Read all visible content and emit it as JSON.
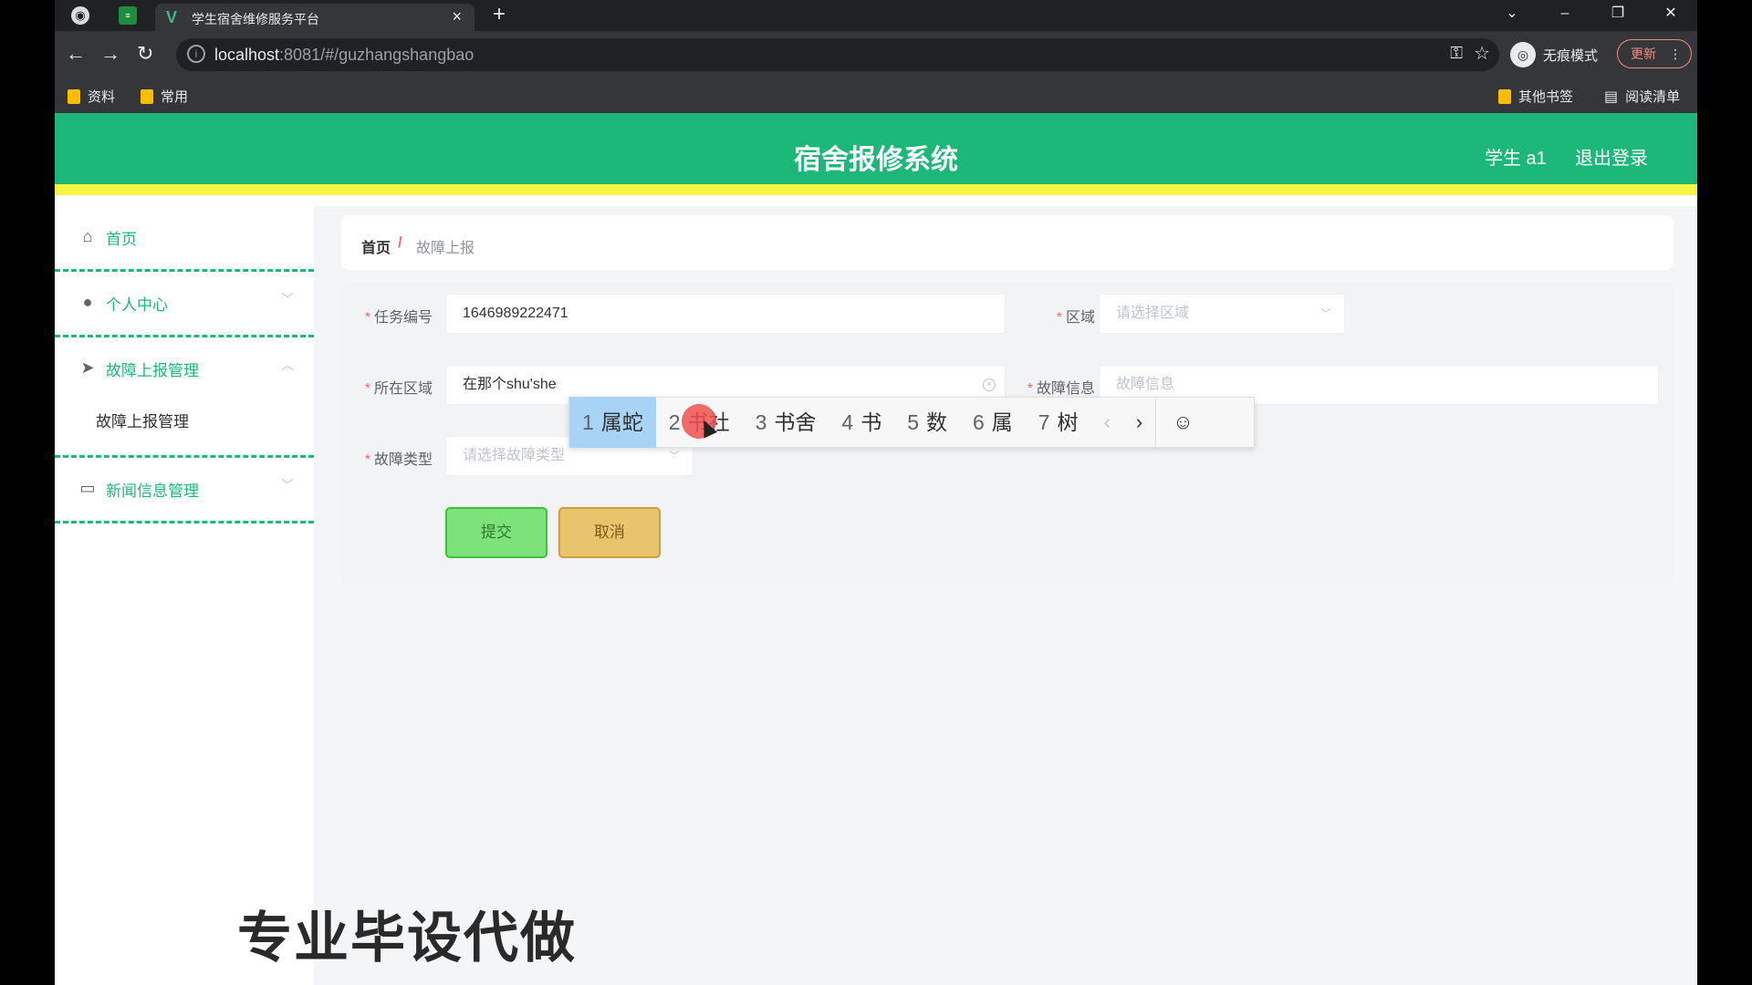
{
  "browser": {
    "tab_title": "学生宿舍维修服务平台",
    "tab_close": "×",
    "new_tab": "+",
    "url_host": "localhost",
    "url_rest": ":8081/#/guzhangshangbao",
    "incognito_label": "无痕模式",
    "update_label": "更新",
    "bookmarks": [
      "资料",
      "常用"
    ],
    "other_bookmarks": "其他书签",
    "reading_list": "阅读清单"
  },
  "header": {
    "title": "宿舍报修系统",
    "user": "学生 a1",
    "logout": "退出登录"
  },
  "sidebar": {
    "items": [
      {
        "label": "首页",
        "icon": "home-icon"
      },
      {
        "label": "个人中心",
        "icon": "user-icon"
      },
      {
        "label": "故障上报管理",
        "icon": "send-icon"
      },
      {
        "label": "新闻信息管理",
        "icon": "news-icon"
      }
    ],
    "submenu_item": "故障上报管理"
  },
  "breadcrumb": {
    "home": "首页",
    "separator": "/",
    "current": "故障上报"
  },
  "form": {
    "task_no_label": "任务编号",
    "task_no_value": "1646989222471",
    "area_label": "区域",
    "area_placeholder": "请选择区域",
    "location_label": "所在区域",
    "location_value": "在那个shu'she",
    "fault_info_label": "故障信息",
    "fault_info_placeholder": "故障信息",
    "fault_type_label": "故障类型",
    "fault_type_placeholder": "请选择故障类型",
    "submit": "提交",
    "cancel": "取消"
  },
  "ime": {
    "candidates": [
      {
        "num": "1",
        "text": "属蛇"
      },
      {
        "num": "2",
        "text": "书社"
      },
      {
        "num": "3",
        "text": "书舍"
      },
      {
        "num": "4",
        "text": "书"
      },
      {
        "num": "5",
        "text": "数"
      },
      {
        "num": "6",
        "text": "属"
      },
      {
        "num": "7",
        "text": "树"
      }
    ],
    "prev": "‹",
    "next": "›",
    "emoji": "☺"
  },
  "watermark": "专业毕设代做"
}
